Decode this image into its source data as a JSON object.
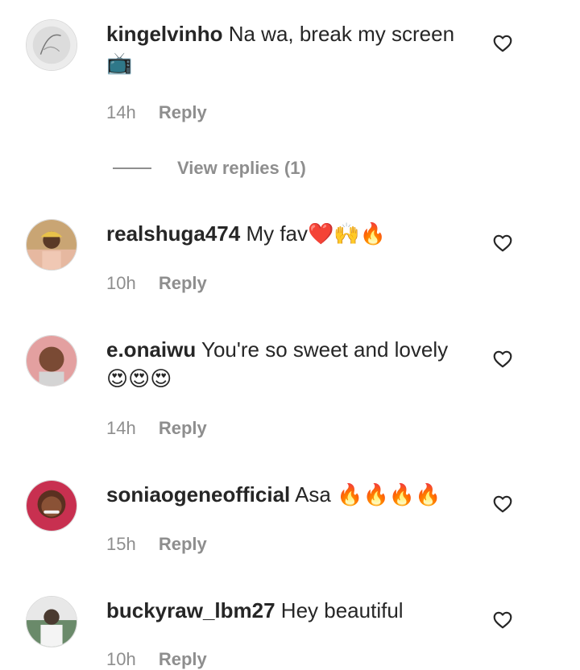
{
  "comments": [
    {
      "username": "kingelvinho",
      "text": "Na wa, break my screen",
      "emoji": "📺",
      "time": "14h",
      "reply_label": "Reply"
    },
    {
      "username": "realshuga474",
      "text": "My fav",
      "emoji": "❤️🙌🔥",
      "time": "10h",
      "reply_label": "Reply"
    },
    {
      "username": "e.onaiwu",
      "text": "You're so sweet and lovely",
      "emoji": "😍😍😍",
      "time": "14h",
      "reply_label": "Reply"
    },
    {
      "username": "soniaogeneofficial",
      "text": "Asa",
      "emoji": "🔥🔥🔥🔥",
      "time": "15h",
      "reply_label": "Reply"
    },
    {
      "username": "buckyraw_lbm27",
      "text": "Hey beautiful",
      "emoji": "",
      "time": "10h",
      "reply_label": "Reply"
    }
  ],
  "view_replies": {
    "label": "View replies (1)"
  },
  "icons": {
    "like": "heart-outline-icon"
  },
  "colors": {
    "text": "#262626",
    "muted": "#8e8e8e",
    "background": "#ffffff"
  }
}
